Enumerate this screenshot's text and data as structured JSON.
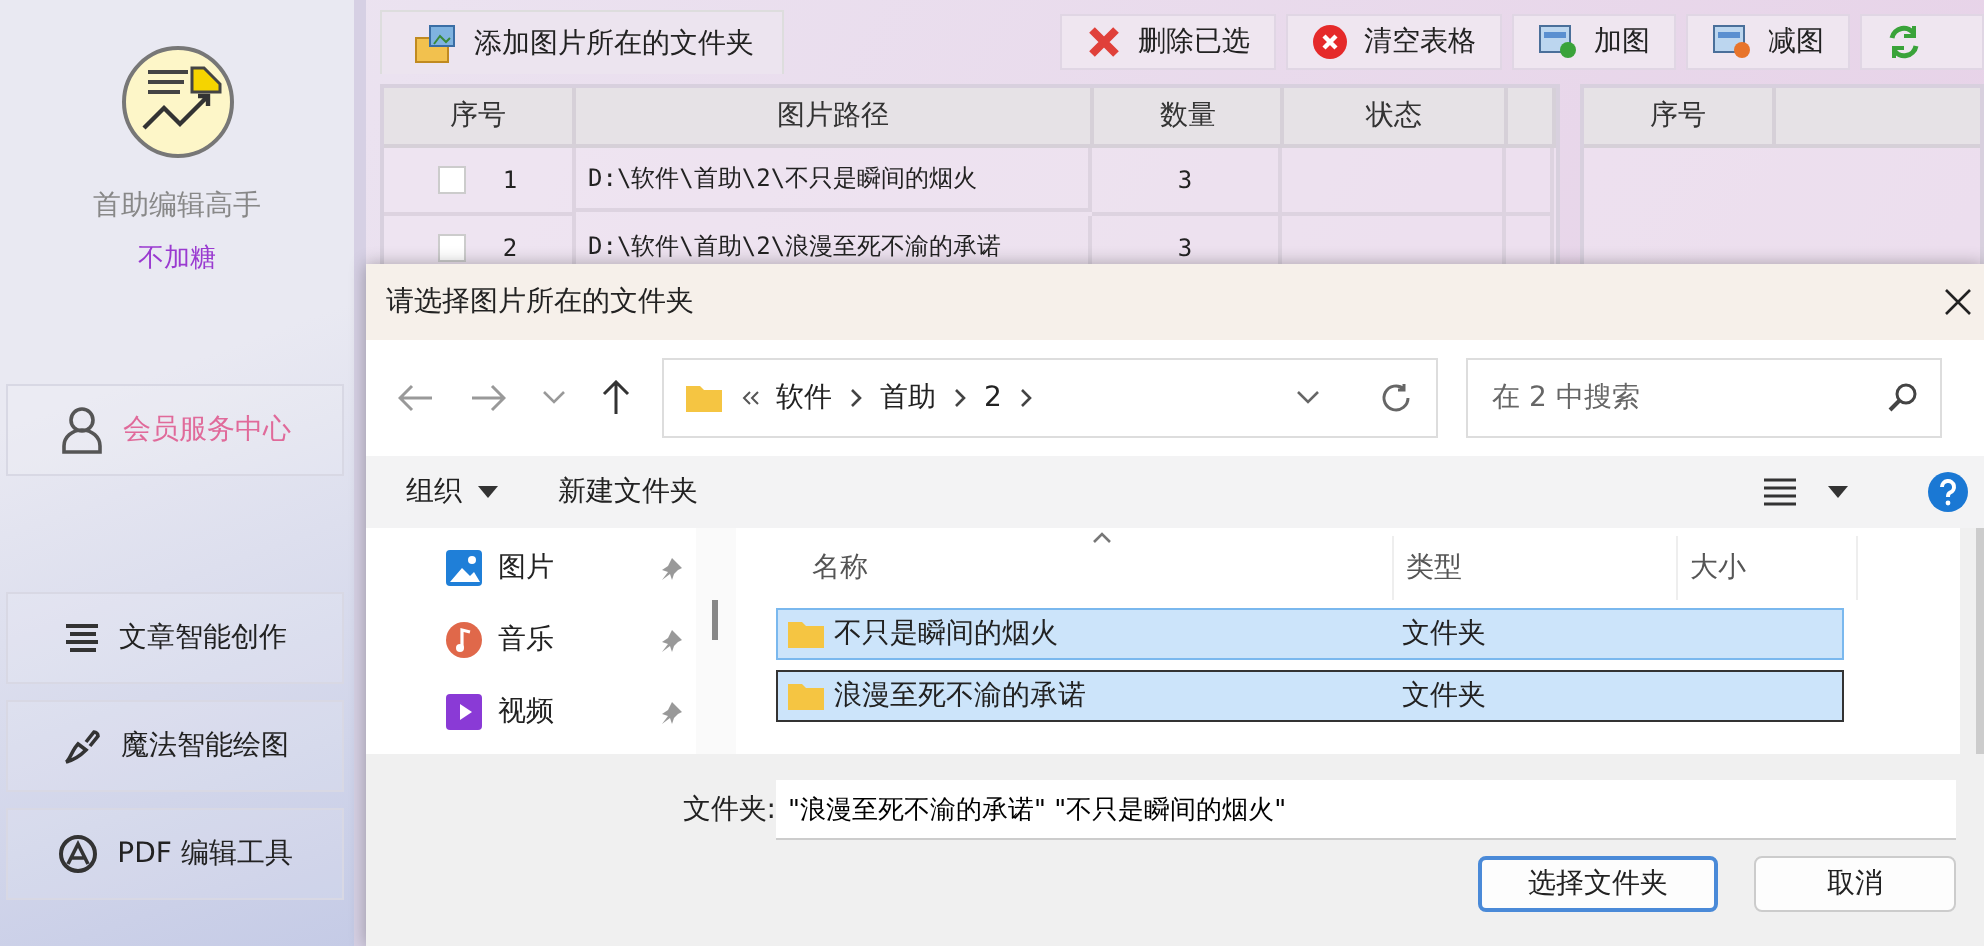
{
  "sidebar": {
    "app_name": "首助编辑高手",
    "subtitle": "不加糖",
    "member_button": "会员服务中心",
    "menu": [
      {
        "label": "文章智能创作",
        "kind": "lines"
      },
      {
        "label": "魔法智能绘图",
        "kind": "brush"
      },
      {
        "label": "PDF 编辑工具",
        "kind": "pdf"
      }
    ]
  },
  "toolbar": {
    "add_folder": "添加图片所在的文件夹",
    "buttons": [
      {
        "label": "删除已选",
        "kind": "delete"
      },
      {
        "label": "清空表格",
        "kind": "clear"
      },
      {
        "label": "加图",
        "kind": "add"
      },
      {
        "label": "减图",
        "kind": "remove"
      },
      {
        "kind": "swap"
      }
    ]
  },
  "table": {
    "columns": [
      "序号",
      "图片路径",
      "数量",
      "状态"
    ],
    "rows": [
      {
        "index": "1",
        "path": "D:\\软件\\首助\\2\\不只是瞬间的烟火",
        "count": "3",
        "checked": false
      },
      {
        "index": "2",
        "path": "D:\\软件\\首助\\2\\浪漫至死不渝的承诺",
        "count": "3",
        "checked": false
      }
    ]
  },
  "right_table": {
    "columns": [
      "序号"
    ]
  },
  "dialog": {
    "title": "请选择图片所在的文件夹",
    "breadcrumb": [
      "软件",
      "首助",
      "2"
    ],
    "search": {
      "placeholder": "在 2 中搜索"
    },
    "commands": [
      "组织",
      "新建文件夹"
    ],
    "nav_items": [
      {
        "label": "图片",
        "kind": "pictures"
      },
      {
        "label": "音乐",
        "kind": "music"
      },
      {
        "label": "视频",
        "kind": "videos"
      }
    ],
    "columns": [
      "名称",
      "类型",
      "大小"
    ],
    "files": [
      {
        "name": "不只是瞬间的烟火",
        "type": "文件夹",
        "selected": true,
        "focused": false
      },
      {
        "name": "浪漫至死不渝的承诺",
        "type": "文件夹",
        "selected": true,
        "focused": true
      }
    ],
    "folder_label": "文件夹:",
    "folder_value": "\"浪漫至死不渝的承诺\" \"不只是瞬间的烟火\"",
    "ok_button": "选择文件夹",
    "cancel_button": "取消"
  }
}
